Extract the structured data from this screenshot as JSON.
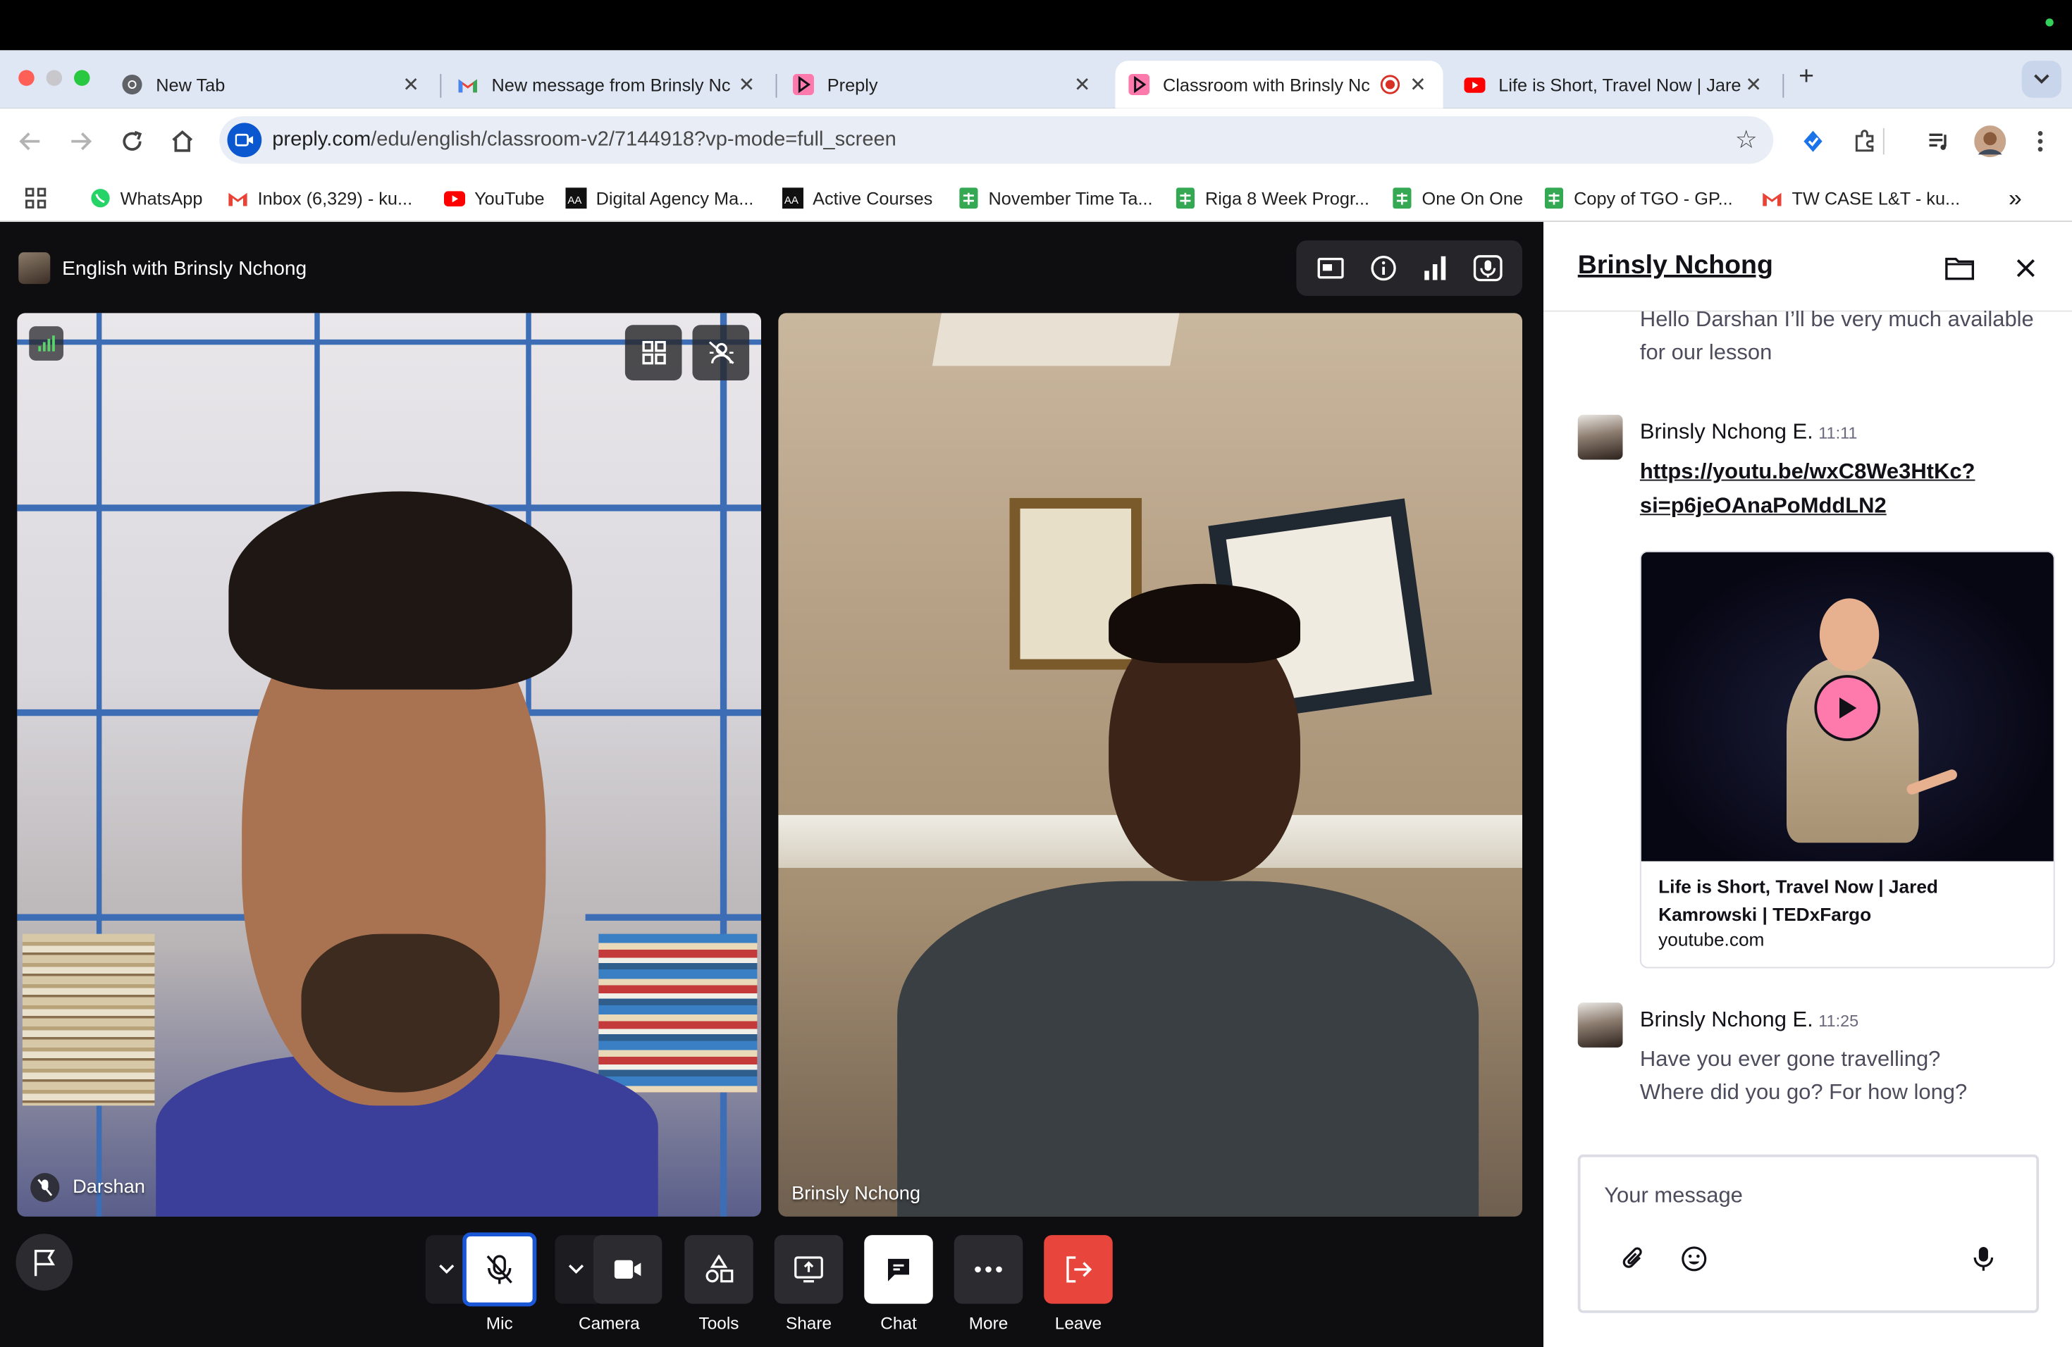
{
  "browser": {
    "tabs": [
      {
        "title": "New Tab",
        "favicon": "chrome-icon"
      },
      {
        "title": "New message from Brinsly Nc",
        "favicon": "gmail-icon"
      },
      {
        "title": "Preply",
        "favicon": "preply-icon"
      },
      {
        "title": "Classroom with Brinsly Nc",
        "favicon": "preply-icon",
        "active": true,
        "recording": true
      },
      {
        "title": "Life is Short, Travel Now | Jare",
        "favicon": "youtube-icon"
      }
    ],
    "new_tab_label": "+",
    "url": {
      "host": "preply.com",
      "path": "/edu/english/classroom-v2/7144918?vp-mode=full_screen"
    },
    "bookmarks": [
      {
        "label": "WhatsApp",
        "icon": "whatsapp-icon"
      },
      {
        "label": "Inbox (6,329) - ku...",
        "icon": "gmail-icon"
      },
      {
        "label": "YouTube",
        "icon": "youtube-icon"
      },
      {
        "label": "Digital Agency Ma...",
        "icon": "aa-icon"
      },
      {
        "label": "Active Courses",
        "icon": "aa-icon"
      },
      {
        "label": "November Time Ta...",
        "icon": "sheets-icon"
      },
      {
        "label": "Riga 8 Week Progr...",
        "icon": "sheets-icon"
      },
      {
        "label": "One On One",
        "icon": "sheets-icon"
      },
      {
        "label": "Copy of TGO - GP...",
        "icon": "sheets-icon"
      },
      {
        "label": "TW CASE L&T - ku...",
        "icon": "gmail-icon"
      }
    ]
  },
  "classroom": {
    "title": "English with Brinsly Nchong",
    "participants": [
      {
        "name": "Darshan",
        "muted": true
      },
      {
        "name": "Brinsly Nchong",
        "muted": false
      }
    ],
    "controls": [
      {
        "label": "Mic",
        "icon": "mic-off-icon"
      },
      {
        "label": "Camera",
        "icon": "camera-icon"
      },
      {
        "label": "Tools",
        "icon": "tools-icon"
      },
      {
        "label": "Share",
        "icon": "share-screen-icon"
      },
      {
        "label": "Chat",
        "icon": "chat-icon"
      },
      {
        "label": "More",
        "icon": "more-icon"
      },
      {
        "label": "Leave",
        "icon": "leave-icon"
      }
    ]
  },
  "chat": {
    "header_name": "Brinsly Nchong",
    "messages": [
      {
        "text": "Hello Darshan I’ll be very much available for our lesson"
      },
      {
        "author": "Brinsly Nchong E.",
        "time": "11:11",
        "link_line1": "https://youtu.be/wxC8We3HtKc?",
        "link_line2": "si=p6jeOAnaPoMddLN2",
        "preview_title": "Life is Short, Travel Now | Jared Kamrowski | TEDxFargo",
        "preview_domain": "youtube.com"
      },
      {
        "author": "Brinsly Nchong E.",
        "time": "11:25",
        "text_line1": "Have you ever gone travelling?",
        "text_line2": "Where did you go? For how long?"
      }
    ],
    "composer_placeholder": "Your message"
  },
  "colors": {
    "leave": "#e8453c",
    "preply_pink": "#ff7aac",
    "mic_ring": "#1a57d6",
    "chrome_blue": "#0b57d0"
  }
}
